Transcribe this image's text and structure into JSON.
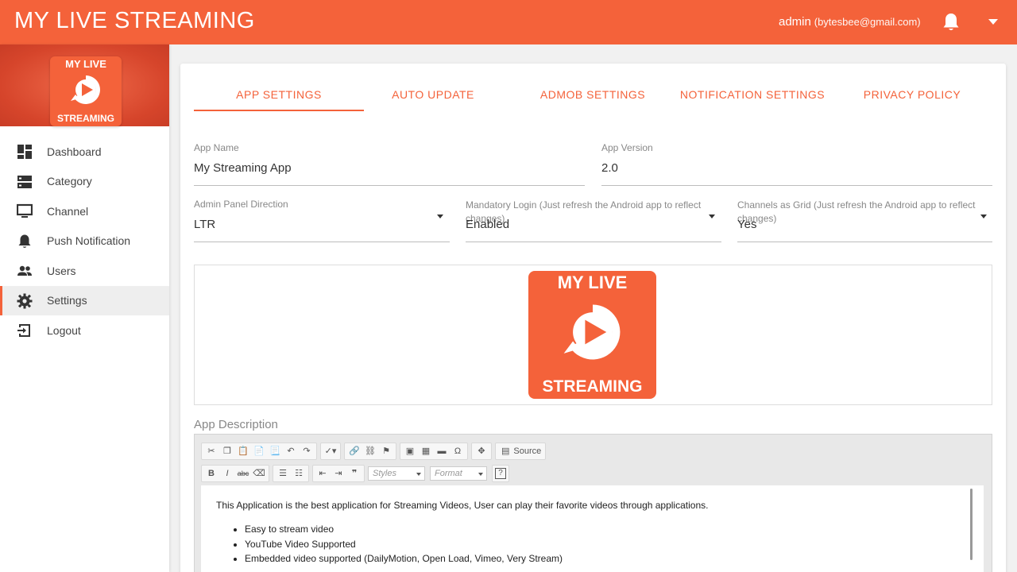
{
  "app": {
    "brand": "MY LIVE STREAMING",
    "user_name": "admin",
    "user_email": "(bytesbee@gmail.com)"
  },
  "logo": {
    "line1": "MY LIVE",
    "line2": "STREAMING"
  },
  "sidebar": {
    "items": [
      {
        "label": "Dashboard",
        "icon": "dashboard-icon"
      },
      {
        "label": "Category",
        "icon": "category-icon"
      },
      {
        "label": "Channel",
        "icon": "monitor-icon"
      },
      {
        "label": "Push Notification",
        "icon": "bell-icon"
      },
      {
        "label": "Users",
        "icon": "users-icon"
      },
      {
        "label": "Settings",
        "icon": "gear-icon",
        "active": true
      },
      {
        "label": "Logout",
        "icon": "logout-icon"
      }
    ]
  },
  "tabs": [
    {
      "label": "APP SETTINGS",
      "active": true
    },
    {
      "label": "AUTO UPDATE"
    },
    {
      "label": "ADMOB SETTINGS"
    },
    {
      "label": "NOTIFICATION SETTINGS"
    },
    {
      "label": "PRIVACY POLICY"
    }
  ],
  "form": {
    "app_name": {
      "label": "App Name",
      "value": "My Streaming App"
    },
    "app_version": {
      "label": "App Version",
      "value": "2.0"
    },
    "direction": {
      "label": "Admin Panel Direction",
      "value": "LTR"
    },
    "mandatory_login": {
      "label": "Mandatory Login (Just refresh the Android app to reflect changes)",
      "value": "Enabled"
    },
    "channels_grid": {
      "label": "Channels as Grid (Just refresh the Android app to reflect changes)",
      "value": "Yes"
    }
  },
  "description": {
    "label": "App Description",
    "paragraph": "This Application is the best application for Streaming Videos, User can play their favorite videos through applications.",
    "bullets": [
      "Easy to stream video",
      "YouTube Video Supported",
      "Embedded video supported (DailyMotion, Open Load, Vimeo, Very Stream)"
    ]
  },
  "editor": {
    "source_label": "Source",
    "styles_placeholder": "Styles",
    "format_placeholder": "Format"
  },
  "colors": {
    "accent": "#f4623a"
  }
}
